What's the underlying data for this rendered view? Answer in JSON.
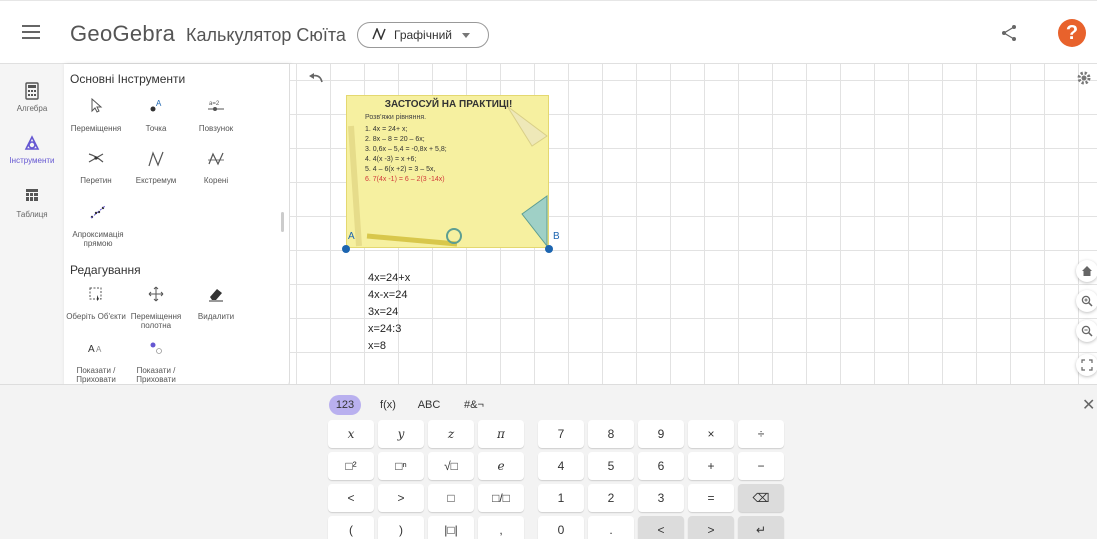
{
  "header": {
    "logo": "GeoGebra",
    "app_name": "Калькулятор Сюїта",
    "mode": "Графічний"
  },
  "nav": [
    {
      "label": "Алгебра",
      "icon": "calculator-icon"
    },
    {
      "label": "Інструменти",
      "icon": "tools-icon"
    },
    {
      "label": "Таблиця",
      "icon": "table-icon"
    }
  ],
  "tools": {
    "basic_title": "Основні Інструменти",
    "basic": [
      "Переміщення",
      "Точка",
      "Повзунок",
      "Перетин",
      "Екстремум",
      "Корені",
      "Апроксимація прямою"
    ],
    "edit_title": "Редагування",
    "edit": [
      "Оберіть Об'єкти",
      "Переміщення полотна",
      "Видалити",
      "Показати / Приховати",
      "Показати / Приховати"
    ]
  },
  "card": {
    "title": "ЗАСТОСУЙ НА ПРАКТИЦІ!",
    "subtitle": "Розв'яжи рівняння.",
    "lines": [
      "1.  4x = 24+ x;",
      "2.  8x – 8 = 20 – 6x;",
      "3.  0,6x – 5,4 = -0,8x + 5,8;",
      "4.  4(x -3) = x +6;",
      "5.  4 – 6(x +2) = 3 – 5x,",
      "6.  7(4x -1) = 6 – 2(3 -14x)"
    ]
  },
  "points": {
    "a": "A",
    "b": "B"
  },
  "solution": [
    "4x=24+x",
    "4x-x=24",
    "3x=24",
    "x=24:3",
    "x=8"
  ],
  "keyboard": {
    "tabs": [
      "123",
      "f(x)",
      "ABC",
      "#&¬"
    ],
    "left_rows": [
      [
        "x",
        "y",
        "z",
        "π"
      ],
      [
        "□²",
        "□ⁿ",
        "√□",
        "e"
      ],
      [
        "<",
        ">",
        "□",
        "□/□"
      ],
      [
        "(",
        ")",
        "|□|",
        ","
      ]
    ],
    "right_rows": [
      [
        "7",
        "8",
        "9",
        "×",
        "÷"
      ],
      [
        "4",
        "5",
        "6",
        "+",
        "−"
      ],
      [
        "1",
        "2",
        "3",
        "=",
        "⌫"
      ],
      [
        "0",
        ".",
        "<",
        ">",
        "↵"
      ]
    ]
  },
  "colors": {
    "accent": "#6557d2",
    "help": "#e8622c",
    "point": "#1c65b0",
    "card": "#f6f0a0"
  }
}
